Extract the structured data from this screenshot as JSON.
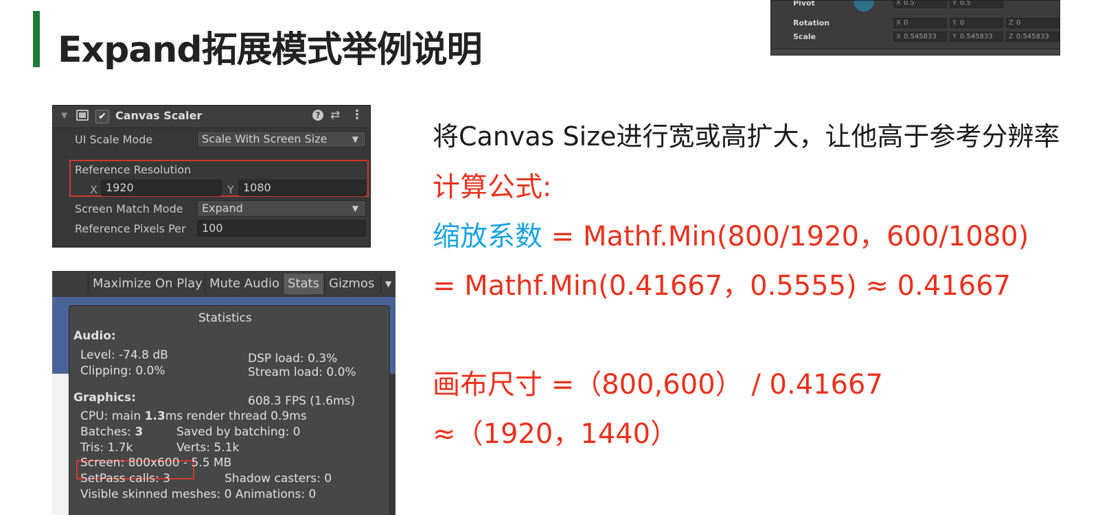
{
  "slide": {
    "title": "Expand拓展模式举例说明",
    "accent_color": "#1f7a3a"
  },
  "inspector_top": {
    "pivot_label": "Pivot",
    "pivot_x": "0.5",
    "pivot_y": "0.5",
    "rotation_label": "Rotation",
    "rotation_x": "0",
    "rotation_y": "0",
    "rotation_z": "0",
    "scale_label": "Scale",
    "scale_x": "0.545833",
    "scale_y": "0.545833",
    "scale_z": "0.545833",
    "axis_x": "X",
    "axis_y": "Y",
    "axis_z": "Z"
  },
  "canvas_scaler": {
    "title": "Canvas Scaler",
    "enabled": "✔",
    "ui_scale_mode_label": "UI Scale Mode",
    "ui_scale_mode_value": "Scale With Screen Size",
    "reference_resolution_label": "Reference Resolution",
    "ref_x_axis": "X",
    "ref_x": "1920",
    "ref_y_axis": "Y",
    "ref_y": "1080",
    "screen_match_mode_label": "Screen Match Mode",
    "screen_match_mode_value": "Expand",
    "ref_pixels_label": "Reference Pixels Per",
    "ref_pixels_value": "100",
    "help_icon": "?",
    "presets_icon": "⇄",
    "more_icon": "⋮"
  },
  "game_toolbar": {
    "maximize_on_play": "Maximize On Play",
    "mute_audio": "Mute Audio",
    "stats": "Stats",
    "gizmos": "Gizmos"
  },
  "statistics": {
    "title": "Statistics",
    "audio_header": "Audio:",
    "level": "Level: -74.8 dB",
    "clipping": "Clipping: 0.0%",
    "dsp_load": "DSP load: 0.3%",
    "stream_load": "Stream load: 0.0%",
    "graphics_header": "Graphics:",
    "fps": "608.3 FPS (1.6ms)",
    "cpu_prefix": "CPU: main ",
    "cpu_main": "1.3",
    "cpu_suffix": "ms  render thread 0.9ms",
    "batches_prefix": "Batches: ",
    "batches": "3",
    "saved_by_batching": "Saved by batching: 0",
    "tris": "Tris: 1.7k",
    "verts": "Verts: 5.1k",
    "screen": "Screen: 800x600 - 5.5 MB",
    "setpass": "SetPass calls: 3",
    "shadow_casters": "Shadow casters: 0",
    "visible_skinned": "Visible skinned meshes: 0  Animations: 0"
  },
  "explanation": {
    "line1": "将Canvas Size进行宽或高扩大，让他高于参考分辨率",
    "formula_label": "计算公式:",
    "scale_factor_label": "缩放系数",
    "formula_line1": " = Mathf.Min(800/1920，600/1080)",
    "formula_line2": "= Mathf.Min(0.41667，0.5555) ≈ 0.41667",
    "canvas_size_line": "画布尺寸  =（800,600） / 0.41667",
    "result_line": "≈（1920，1440）"
  }
}
